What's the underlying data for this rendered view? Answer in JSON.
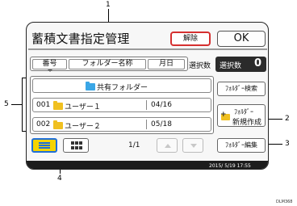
{
  "screen": {
    "title": "蓄積文書指定管理",
    "delete_label": "解除",
    "ok_label": "OK",
    "selected_label": "選択数",
    "selected_box_label": "選択数",
    "selected_count": "0"
  },
  "columns": {
    "number": "番号",
    "folder_name": "フォルダー名称",
    "date": "月日"
  },
  "list": {
    "shared_folder": "共有フォルダー",
    "rows": [
      {
        "number": "001",
        "name": "ユーザー１",
        "date": "04/16"
      },
      {
        "number": "002",
        "name": "ユーザー２",
        "date": "05/18"
      }
    ]
  },
  "side_buttons": {
    "folder_search": "ﾌｫﾙﾀﾞｰ検索",
    "new_folder_line1": "ﾌｫﾙﾀﾞｰ",
    "new_folder_line2": "新規作成",
    "folder_edit": "ﾌｫﾙﾀﾞｰ編集"
  },
  "pagination": {
    "page": "1/1"
  },
  "status_bar": {
    "datetime": "2015/ 5/19 17:55"
  },
  "callouts": {
    "c1": "1",
    "c2": "2",
    "c3": "3",
    "c4": "4",
    "c5": "5"
  },
  "figure_code": "DLM368",
  "colors": {
    "accent_red": "#d53030",
    "folder_blue": "#3aa6e6",
    "folder_yellow": "#f0c020",
    "list_view_active": "#f5d400"
  }
}
